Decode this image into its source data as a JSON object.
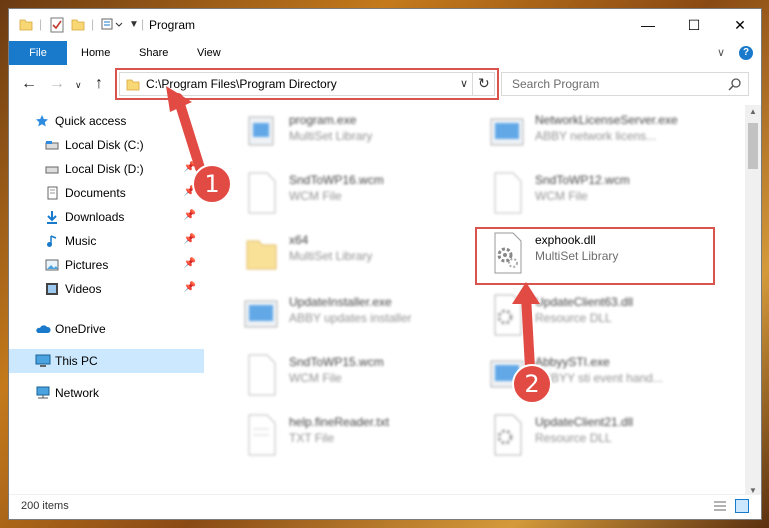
{
  "window": {
    "title": "Program",
    "minimize_glyph": "—",
    "maximize_glyph": "☐",
    "close_glyph": "✕"
  },
  "ribbon": {
    "tabs": [
      {
        "label": "File"
      },
      {
        "label": "Home"
      },
      {
        "label": "Share"
      },
      {
        "label": "View"
      }
    ],
    "help_glyph": "?",
    "expand_glyph": "∨"
  },
  "address": {
    "path": "C:\\Program Files\\Program Directory",
    "dropdown_glyph": "∨",
    "refresh_glyph": "↻"
  },
  "search": {
    "placeholder": "Search Program"
  },
  "nav": {
    "back_glyph": "←",
    "forward_glyph": "→",
    "dropdown_glyph": "∨",
    "up_glyph": "↑"
  },
  "sidebar": {
    "items": [
      {
        "label": "Quick access",
        "icon": "star-icon"
      },
      {
        "label": "Local Disk (C:)",
        "icon": "drive-icon"
      },
      {
        "label": "Local Disk (D:)",
        "icon": "drive-icon"
      },
      {
        "label": "Documents",
        "icon": "documents-icon"
      },
      {
        "label": "Downloads",
        "icon": "downloads-icon"
      },
      {
        "label": "Music",
        "icon": "music-icon"
      },
      {
        "label": "Pictures",
        "icon": "pictures-icon"
      },
      {
        "label": "Videos",
        "icon": "videos-icon"
      },
      {
        "label": "OneDrive",
        "icon": "cloud-icon"
      },
      {
        "label": "This PC",
        "icon": "computer-icon"
      },
      {
        "label": "Network",
        "icon": "network-icon"
      }
    ]
  },
  "files": [
    {
      "name": "program.exe",
      "type": "MultiSet Library"
    },
    {
      "name": "NetworkLicenseServer.exe",
      "type": "ABBY network licens..."
    },
    {
      "name": "SndToWP16.wcm",
      "type": "WCM File"
    },
    {
      "name": "SndToWP12.wcm",
      "type": "WCM File"
    },
    {
      "name": "x64",
      "type": "MultiSet Library"
    },
    {
      "name": "exphook.dll",
      "type": "MultiSet Library"
    },
    {
      "name": "UpdateInstaller.exe",
      "type": "ABBY updates installer"
    },
    {
      "name": "UpdateClient63.dll",
      "type": "Resource DLL"
    },
    {
      "name": "SndToWP15.wcm",
      "type": "WCM File"
    },
    {
      "name": "AbbyySTI.exe",
      "type": "ABBYY sti event hand..."
    },
    {
      "name": "help.fineReader.txt",
      "type": "TXT File"
    },
    {
      "name": "UpdateClient21.dll",
      "type": "Resource DLL"
    }
  ],
  "status": {
    "item_count": "200 items"
  },
  "callouts": {
    "step1": "1",
    "step2": "2",
    "color": "#e24b44"
  }
}
